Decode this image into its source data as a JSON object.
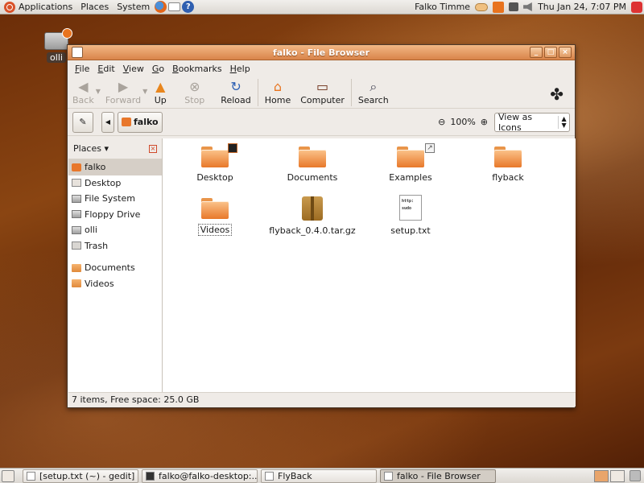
{
  "top_panel": {
    "menus": [
      "Applications",
      "Places",
      "System"
    ],
    "user": "Falko Timme",
    "datetime": "Thu Jan 24,  7:07 PM"
  },
  "desktop": {
    "icon_label": "olli"
  },
  "window": {
    "title": "falko - File Browser",
    "menubar": [
      {
        "key": "F",
        "rest": "ile"
      },
      {
        "key": "E",
        "rest": "dit"
      },
      {
        "key": "V",
        "rest": "iew"
      },
      {
        "key": "G",
        "rest": "o"
      },
      {
        "key": "B",
        "rest": "ookmarks"
      },
      {
        "key": "H",
        "rest": "elp"
      }
    ],
    "toolbar": {
      "back": "Back",
      "forward": "Forward",
      "up": "Up",
      "stop": "Stop",
      "reload": "Reload",
      "home": "Home",
      "computer": "Computer",
      "search": "Search"
    },
    "location": {
      "path_button": "falko",
      "zoom": "100%",
      "view_mode": "View as Icons"
    },
    "sidebar": {
      "title": "Places",
      "items": [
        "falko",
        "Desktop",
        "File System",
        "Floppy Drive",
        "olli",
        "Trash"
      ],
      "bookmarks": [
        "Documents",
        "Videos"
      ]
    },
    "files": [
      {
        "name": "Desktop",
        "type": "folder"
      },
      {
        "name": "Documents",
        "type": "folder"
      },
      {
        "name": "Examples",
        "type": "folder"
      },
      {
        "name": "flyback",
        "type": "folder"
      },
      {
        "name": "Videos",
        "type": "folder"
      },
      {
        "name": "flyback_0.4.0.tar.gz",
        "type": "archive"
      },
      {
        "name": "setup.txt",
        "type": "text",
        "preview_lines": [
          "http:",
          "sudo"
        ]
      }
    ],
    "status": "7 items, Free space: 25.0 GB"
  },
  "taskbar": {
    "tasks": [
      "[setup.txt (~) - gedit]",
      "falko@falko-desktop:...",
      "FlyBack",
      "falko - File Browser"
    ]
  }
}
